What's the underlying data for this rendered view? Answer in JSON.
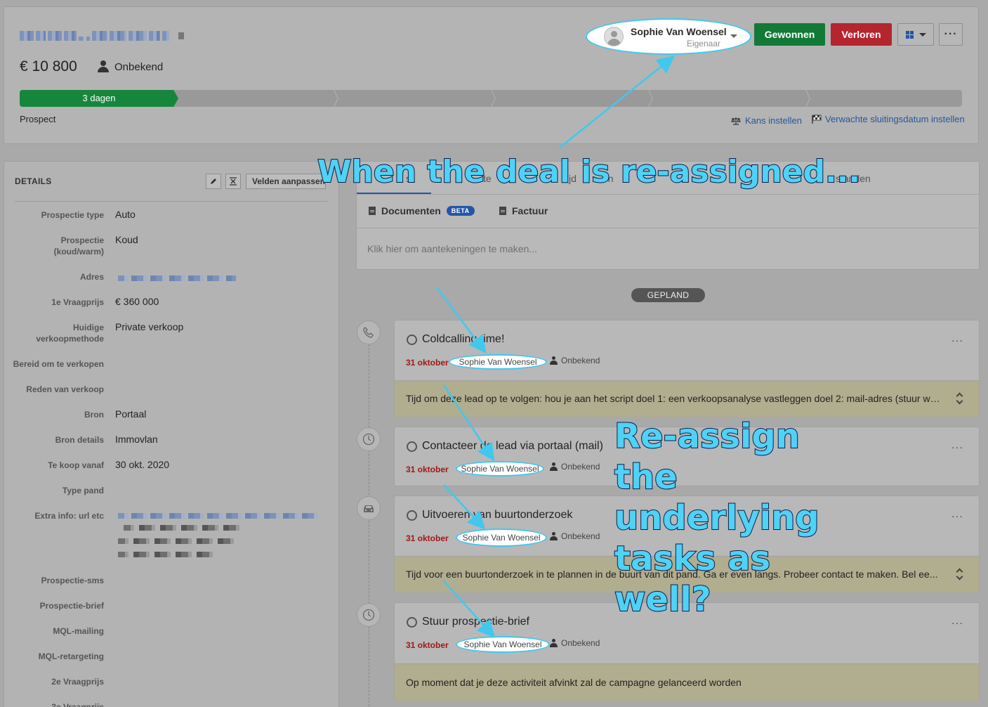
{
  "deal": {
    "amount": "€ 10 800",
    "contact": "Onbekend",
    "progress_label": "3 dagen",
    "stage": "Prospect",
    "set_chance_label": "Kans instellen",
    "set_closing_date_label": "Verwachte sluitingsdatum instellen",
    "owner": {
      "name": "Sophie Van Woensel",
      "role": "Eigenaar"
    },
    "won_label": "Gewonnen",
    "lost_label": "Verloren",
    "more_label": "···"
  },
  "details": {
    "title": "DETAILS",
    "customize_label": "Velden aanpassen",
    "fields": [
      {
        "label": "Prospectie type",
        "value": "Auto"
      },
      {
        "label": "Prospectie (koud/warm)",
        "value": "Koud"
      },
      {
        "label": "Adres",
        "value": ""
      },
      {
        "label": "1e Vraagprijs",
        "value": "€ 360 000"
      },
      {
        "label": "Huidige verkoopmethode",
        "value": "Private verkoop"
      },
      {
        "label": "Bereid om te verkopen",
        "value": ""
      },
      {
        "label": "Reden van verkoop",
        "value": ""
      },
      {
        "label": "Bron",
        "value": "Portaal"
      },
      {
        "label": "Bron details",
        "value": "Immovlan"
      },
      {
        "label": "Te koop vanaf",
        "value": "30 okt. 2020"
      },
      {
        "label": "Type pand",
        "value": ""
      },
      {
        "label": "Extra info: url etc",
        "value": ""
      },
      {
        "label": "Prospectie-sms",
        "value": ""
      },
      {
        "label": "Prospectie-brief",
        "value": ""
      },
      {
        "label": "MQL-mailing",
        "value": ""
      },
      {
        "label": "MQL-retargeting",
        "value": ""
      },
      {
        "label": "2e Vraagprijs",
        "value": ""
      },
      {
        "label": "3e Vraagprijs",
        "value": ""
      }
    ]
  },
  "notes": {
    "tab_fragments": [
      "s",
      "te",
      "tijd",
      "en",
      "standen"
    ],
    "documents_label": "Documenten",
    "beta_label": "BETA",
    "invoice_label": "Factuur",
    "placeholder": "Klik hier om aantekeningen te maken..."
  },
  "timeline": {
    "section_label": "GEPLAND",
    "tasks": [
      {
        "title": "Coldcalling time!",
        "date": "31 oktober",
        "assignee": "Sophie Van Woensel",
        "contact": "Onbekend",
        "icon": "phone-icon",
        "note": "Tijd om deze lead op te volgen: hou je aan het script doel 1: een verkoopsanalyse vastleggen doel 2: mail-adres (stuur wa..."
      },
      {
        "title": "Contacteer de lead via portaal (mail)",
        "date": "31 oktober",
        "assignee": "Sophie Van Woensel",
        "contact": "Onbekend",
        "icon": "clock-icon",
        "note": ""
      },
      {
        "title": "Uitvoeren van buurtonderzoek",
        "date": "31 oktober",
        "assignee": "Sophie Van Woensel",
        "contact": "Onbekend",
        "icon": "car-icon",
        "note": "Tijd voor een buurtonderzoek in te plannen in de buurt van dit pand. Ga er even langs. Probeer contact te maken. Bel ee..."
      },
      {
        "title": "Stuur prospectie-brief",
        "date": "31 oktober",
        "assignee": "Sophie Van Woensel",
        "contact": "Onbekend",
        "icon": "clock-icon",
        "note": "Op moment dat je deze activiteit afvinkt zal de campagne gelanceerd worden"
      }
    ]
  },
  "annotations": {
    "top": "When the deal is re-assigned...",
    "right": "Re-assign the underlying tasks as well?",
    "color": "#4fd2f6"
  }
}
